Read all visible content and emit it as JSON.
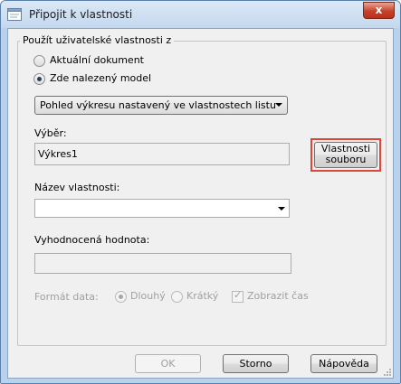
{
  "window": {
    "title": "Připojit k vlastnosti",
    "close_glyph": "x",
    "icon": "app-icon"
  },
  "group": {
    "caption": "Použít uživatelské vlastnosti z"
  },
  "source_options": [
    {
      "label": "Aktuální dokument",
      "checked": false
    },
    {
      "label": "Zde nalezený model",
      "checked": true
    }
  ],
  "view_combo": {
    "value": "Pohled výkresu nastavený ve vlastnostech listu"
  },
  "selection": {
    "label": "Výběr:",
    "value": "Výkres1"
  },
  "file_properties_button": {
    "line1": "Vlastnosti",
    "line2": "souboru"
  },
  "property_name": {
    "label": "Název vlastnosti:",
    "value": ""
  },
  "evaluated_value": {
    "label": "Vyhodnocená hodnota:",
    "value": ""
  },
  "date_format": {
    "label": "Formát data:",
    "options": [
      {
        "label": "Dlouhý",
        "checked": true
      },
      {
        "label": "Krátký",
        "checked": false
      }
    ],
    "show_time": {
      "label": "Zobrazit čas",
      "checked": true
    }
  },
  "buttons": {
    "ok": "OK",
    "cancel": "Storno",
    "help": "Nápověda"
  }
}
